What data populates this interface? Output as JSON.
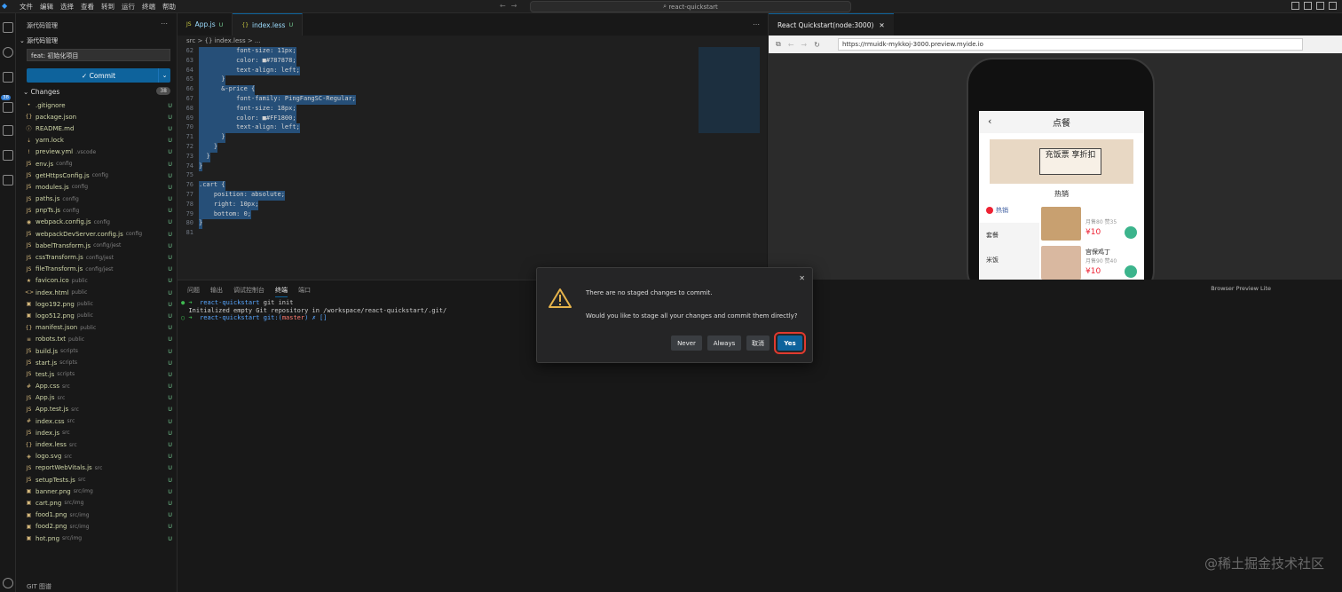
{
  "titlebar": {
    "menus": [
      "文件",
      "编辑",
      "选择",
      "查看",
      "转到",
      "运行",
      "终端",
      "帮助"
    ],
    "search": "react-quickstart"
  },
  "activity": {
    "badge": "38"
  },
  "sidebar": {
    "header": "源代码管理",
    "repo": "源代码管理",
    "commit_message": "feat: 初始化项目",
    "commit_button": "✓ Commit",
    "changes_label": "Changes",
    "changes_count": "38",
    "files": [
      {
        "icon": "•",
        "name": ".gitignore",
        "dir": "",
        "status": "U"
      },
      {
        "icon": "{}",
        "name": "package.json",
        "dir": "",
        "status": "U"
      },
      {
        "icon": "ⓘ",
        "name": "README.md",
        "dir": "",
        "status": "U"
      },
      {
        "icon": "⇣",
        "name": "yarn.lock",
        "dir": "",
        "status": "U"
      },
      {
        "icon": "!",
        "name": "preview.yml",
        "dir": ".vscode",
        "status": "U"
      },
      {
        "icon": "JS",
        "name": "env.js",
        "dir": "config",
        "status": "U"
      },
      {
        "icon": "JS",
        "name": "getHttpsConfig.js",
        "dir": "config",
        "status": "U"
      },
      {
        "icon": "JS",
        "name": "modules.js",
        "dir": "config",
        "status": "U"
      },
      {
        "icon": "JS",
        "name": "paths.js",
        "dir": "config",
        "status": "U"
      },
      {
        "icon": "JS",
        "name": "pnpTs.js",
        "dir": "config",
        "status": "U"
      },
      {
        "icon": "◉",
        "name": "webpack.config.js",
        "dir": "config",
        "status": "U"
      },
      {
        "icon": "JS",
        "name": "webpackDevServer.config.js",
        "dir": "config",
        "status": "U"
      },
      {
        "icon": "JS",
        "name": "babelTransform.js",
        "dir": "config/jest",
        "status": "U"
      },
      {
        "icon": "JS",
        "name": "cssTransform.js",
        "dir": "config/jest",
        "status": "U"
      },
      {
        "icon": "JS",
        "name": "fileTransform.js",
        "dir": "config/jest",
        "status": "U"
      },
      {
        "icon": "★",
        "name": "favicon.ico",
        "dir": "public",
        "status": "U"
      },
      {
        "icon": "<>",
        "name": "index.html",
        "dir": "public",
        "status": "U"
      },
      {
        "icon": "▣",
        "name": "logo192.png",
        "dir": "public",
        "status": "U"
      },
      {
        "icon": "▣",
        "name": "logo512.png",
        "dir": "public",
        "status": "U"
      },
      {
        "icon": "{}",
        "name": "manifest.json",
        "dir": "public",
        "status": "U"
      },
      {
        "icon": "≡",
        "name": "robots.txt",
        "dir": "public",
        "status": "U"
      },
      {
        "icon": "JS",
        "name": "build.js",
        "dir": "scripts",
        "status": "U"
      },
      {
        "icon": "JS",
        "name": "start.js",
        "dir": "scripts",
        "status": "U"
      },
      {
        "icon": "JS",
        "name": "test.js",
        "dir": "scripts",
        "status": "U"
      },
      {
        "icon": "#",
        "name": "App.css",
        "dir": "src",
        "status": "U"
      },
      {
        "icon": "JS",
        "name": "App.js",
        "dir": "src",
        "status": "U"
      },
      {
        "icon": "JS",
        "name": "App.test.js",
        "dir": "src",
        "status": "U"
      },
      {
        "icon": "#",
        "name": "index.css",
        "dir": "src",
        "status": "U"
      },
      {
        "icon": "JS",
        "name": "index.js",
        "dir": "src",
        "status": "U"
      },
      {
        "icon": "{}",
        "name": "index.less",
        "dir": "src",
        "status": "U"
      },
      {
        "icon": "◈",
        "name": "logo.svg",
        "dir": "src",
        "status": "U"
      },
      {
        "icon": "JS",
        "name": "reportWebVitals.js",
        "dir": "src",
        "status": "U"
      },
      {
        "icon": "JS",
        "name": "setupTests.js",
        "dir": "src",
        "status": "U"
      },
      {
        "icon": "▣",
        "name": "banner.png",
        "dir": "src/img",
        "status": "U"
      },
      {
        "icon": "▣",
        "name": "cart.png",
        "dir": "src/img",
        "status": "U"
      },
      {
        "icon": "▣",
        "name": "food1.png",
        "dir": "src/img",
        "status": "U"
      },
      {
        "icon": "▣",
        "name": "food2.png",
        "dir": "src/img",
        "status": "U"
      },
      {
        "icon": "▣",
        "name": "hot.png",
        "dir": "src/img",
        "status": "U"
      }
    ],
    "footer": "GIT 图谱"
  },
  "editor": {
    "tabs": [
      {
        "icon": "JS",
        "label": "App.js",
        "status": "U"
      },
      {
        "icon": "{}",
        "label": "index.less",
        "status": "U"
      }
    ],
    "breadcrumb": "src > {} index.less > ...",
    "lines": [
      {
        "n": "62",
        "t": "          font-size: 11px;"
      },
      {
        "n": "63",
        "t": "          color: ■#787878;"
      },
      {
        "n": "64",
        "t": "          text-align: left;"
      },
      {
        "n": "65",
        "t": "      }"
      },
      {
        "n": "66",
        "t": "      &-price {"
      },
      {
        "n": "67",
        "t": "          font-family: PingFangSC-Regular;"
      },
      {
        "n": "68",
        "t": "          font-size: 18px;"
      },
      {
        "n": "69",
        "t": "          color: ■#FF1800;"
      },
      {
        "n": "70",
        "t": "          text-align: left;"
      },
      {
        "n": "71",
        "t": "      }"
      },
      {
        "n": "72",
        "t": "    }"
      },
      {
        "n": "73",
        "t": "  }"
      },
      {
        "n": "74",
        "t": "}"
      },
      {
        "n": "75",
        "t": ""
      },
      {
        "n": "76",
        "t": ".cart {"
      },
      {
        "n": "77",
        "t": "    position: absolute;"
      },
      {
        "n": "78",
        "t": "    right: 10px;"
      },
      {
        "n": "79",
        "t": "    bottom: 0;"
      },
      {
        "n": "80",
        "t": "}"
      },
      {
        "n": "81",
        "t": ""
      }
    ]
  },
  "panel": {
    "tabs": [
      "问题",
      "输出",
      "调试控制台",
      "终端",
      "端口"
    ],
    "active_tab": "终端",
    "terminal": {
      "line1_dir": "react-quickstart",
      "line1_cmd": " git init",
      "line2": "Initialized empty Git repository in /workspace/react-quickstart/.git/",
      "line3_dir": "react-quickstart",
      "line3_git": " git:(",
      "line3_branch": "master",
      "line3_end": ") ✗ []"
    }
  },
  "preview": {
    "tab_label": "React Quickstart(node:3000)",
    "url": "https://rmuidk-mykkoj-3000.preview.myide.io",
    "bottom_label": "Browser Preview Lite",
    "app": {
      "title": "点餐",
      "banner_text": "充饭票 享折扣",
      "hot_title": "热销",
      "categories": [
        "热销",
        "套餐",
        "米饭"
      ],
      "foods": [
        {
          "name": "",
          "sales": "月售80 赞35",
          "price": "¥10"
        },
        {
          "name": "宫保鸡丁",
          "sales": "月售90 赞40",
          "price": "¥10"
        }
      ]
    }
  },
  "dialog": {
    "message1": "There are no staged changes to commit.",
    "message2": "Would you like to stage all your changes and commit them directly?",
    "buttons": {
      "never": "Never",
      "always": "Always",
      "cancel": "取消",
      "yes": "Yes"
    }
  },
  "watermark": "@稀土掘金技术社区"
}
